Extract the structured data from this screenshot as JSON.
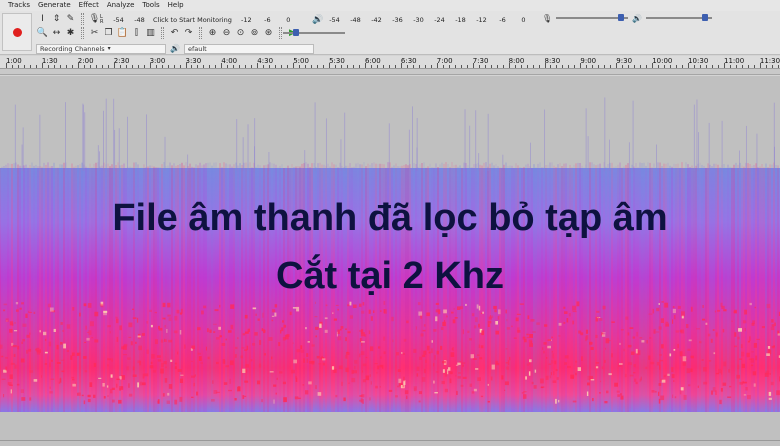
{
  "menu": [
    "Tracks",
    "Generate",
    "Effect",
    "Analyze",
    "Tools",
    "Help"
  ],
  "toolbar": {
    "record_meter_channels": "L\nR",
    "record_meter_ticks": [
      "-54",
      "-48"
    ],
    "record_meter_prompt": "Click to Start Monitoring",
    "record_meter_ticks_after": [
      "-12",
      "-6",
      "0"
    ],
    "playback_meter_ticks": [
      "-54",
      "-48",
      "-42",
      "-36",
      "-30",
      "-24",
      "-18",
      "-12",
      "-6",
      "0"
    ],
    "recording_channels": "Recording Channels",
    "output_device": "efault"
  },
  "ruler": {
    "labels": [
      "1:00",
      "1:30",
      "2:00",
      "2:30",
      "3:00",
      "3:30",
      "4:00",
      "4:30",
      "5:00",
      "5:30",
      "6:00",
      "6:30",
      "7:00",
      "7:30",
      "8:00",
      "8:30",
      "9:00",
      "9:30",
      "10:00",
      "10:30",
      "11:00",
      "11:30"
    ]
  },
  "overlay": {
    "line1": "File âm thanh đã lọc bỏ tạp âm",
    "line2": "Cắt tại 2 Khz"
  },
  "colors": {
    "record": "#e0201e",
    "spectrogram_low": "#7a8ae0",
    "spectrogram_mid": "#c23ad0",
    "spectrogram_high": "#ff2c6e",
    "overlay_text": "#0e1240"
  }
}
